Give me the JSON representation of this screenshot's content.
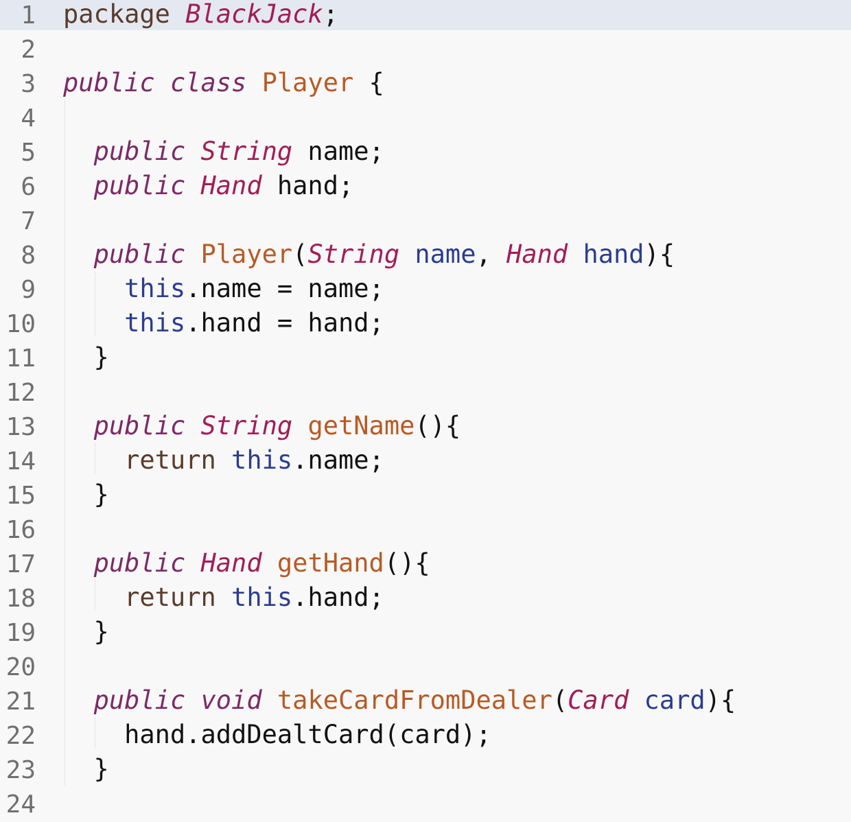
{
  "editor": {
    "language": "java",
    "active_line": 1,
    "lines": [
      {
        "num": "1",
        "tokens": [
          [
            "rt",
            "package"
          ],
          [
            "pl",
            " "
          ],
          [
            "ty",
            "BlackJack"
          ],
          [
            "pl",
            ";"
          ]
        ]
      },
      {
        "num": "2",
        "tokens": []
      },
      {
        "num": "3",
        "tokens": [
          [
            "kw",
            "public"
          ],
          [
            "pl",
            " "
          ],
          [
            "kw",
            "class"
          ],
          [
            "pl",
            " "
          ],
          [
            "fn",
            "Player"
          ],
          [
            "pl",
            " {"
          ]
        ]
      },
      {
        "num": "4",
        "tokens": []
      },
      {
        "num": "5",
        "tokens": [
          [
            "pl",
            "  "
          ],
          [
            "kw",
            "public"
          ],
          [
            "pl",
            " "
          ],
          [
            "ty",
            "String"
          ],
          [
            "pl",
            " name;"
          ]
        ]
      },
      {
        "num": "6",
        "tokens": [
          [
            "pl",
            "  "
          ],
          [
            "kw",
            "public"
          ],
          [
            "pl",
            " "
          ],
          [
            "ty",
            "Hand"
          ],
          [
            "pl",
            " hand;"
          ]
        ]
      },
      {
        "num": "7",
        "tokens": []
      },
      {
        "num": "8",
        "tokens": [
          [
            "pl",
            "  "
          ],
          [
            "kw",
            "public"
          ],
          [
            "pl",
            " "
          ],
          [
            "fn",
            "Player"
          ],
          [
            "pl",
            "("
          ],
          [
            "ty",
            "String"
          ],
          [
            "pl",
            " "
          ],
          [
            "id",
            "name"
          ],
          [
            "pl",
            ", "
          ],
          [
            "ty",
            "Hand"
          ],
          [
            "pl",
            " "
          ],
          [
            "id",
            "hand"
          ],
          [
            "pl",
            "){"
          ]
        ]
      },
      {
        "num": "9",
        "tokens": [
          [
            "pl",
            "    "
          ],
          [
            "id",
            "this"
          ],
          [
            "pl",
            ".name = name;"
          ]
        ]
      },
      {
        "num": "10",
        "tokens": [
          [
            "pl",
            "    "
          ],
          [
            "id",
            "this"
          ],
          [
            "pl",
            ".hand = hand;"
          ]
        ]
      },
      {
        "num": "11",
        "tokens": [
          [
            "pl",
            "  }"
          ]
        ]
      },
      {
        "num": "12",
        "tokens": []
      },
      {
        "num": "13",
        "tokens": [
          [
            "pl",
            "  "
          ],
          [
            "kw",
            "public"
          ],
          [
            "pl",
            " "
          ],
          [
            "ty",
            "String"
          ],
          [
            "pl",
            " "
          ],
          [
            "fn",
            "getName"
          ],
          [
            "pl",
            "(){"
          ]
        ]
      },
      {
        "num": "14",
        "tokens": [
          [
            "pl",
            "    "
          ],
          [
            "rt",
            "return"
          ],
          [
            "pl",
            " "
          ],
          [
            "id",
            "this"
          ],
          [
            "pl",
            ".name;"
          ]
        ]
      },
      {
        "num": "15",
        "tokens": [
          [
            "pl",
            "  }"
          ]
        ]
      },
      {
        "num": "16",
        "tokens": []
      },
      {
        "num": "17",
        "tokens": [
          [
            "pl",
            "  "
          ],
          [
            "kw",
            "public"
          ],
          [
            "pl",
            " "
          ],
          [
            "ty",
            "Hand"
          ],
          [
            "pl",
            " "
          ],
          [
            "fn",
            "getHand"
          ],
          [
            "pl",
            "(){"
          ]
        ]
      },
      {
        "num": "18",
        "tokens": [
          [
            "pl",
            "    "
          ],
          [
            "rt",
            "return"
          ],
          [
            "pl",
            " "
          ],
          [
            "id",
            "this"
          ],
          [
            "pl",
            ".hand;"
          ]
        ]
      },
      {
        "num": "19",
        "tokens": [
          [
            "pl",
            "  }"
          ]
        ]
      },
      {
        "num": "20",
        "tokens": []
      },
      {
        "num": "21",
        "tokens": [
          [
            "pl",
            "  "
          ],
          [
            "kw",
            "public"
          ],
          [
            "pl",
            " "
          ],
          [
            "kw",
            "void"
          ],
          [
            "pl",
            " "
          ],
          [
            "fn",
            "takeCardFromDealer"
          ],
          [
            "pl",
            "("
          ],
          [
            "ty",
            "Card"
          ],
          [
            "pl",
            " "
          ],
          [
            "id",
            "card"
          ],
          [
            "pl",
            "){"
          ]
        ]
      },
      {
        "num": "22",
        "tokens": [
          [
            "pl",
            "    hand.addDealtCard(card);"
          ]
        ]
      },
      {
        "num": "23",
        "tokens": [
          [
            "pl",
            "  }"
          ]
        ]
      },
      {
        "num": "24",
        "tokens": []
      }
    ]
  },
  "colors": {
    "background": "#f8f8f8",
    "active_line": "#e4e9f1",
    "line_number": "#6f6f6f",
    "keyword": "#7c2a66",
    "type": "#a21d57",
    "function": "#b85a24",
    "identifier": "#2a3d8f",
    "return": "#5a3b2c",
    "plain": "#111111"
  }
}
